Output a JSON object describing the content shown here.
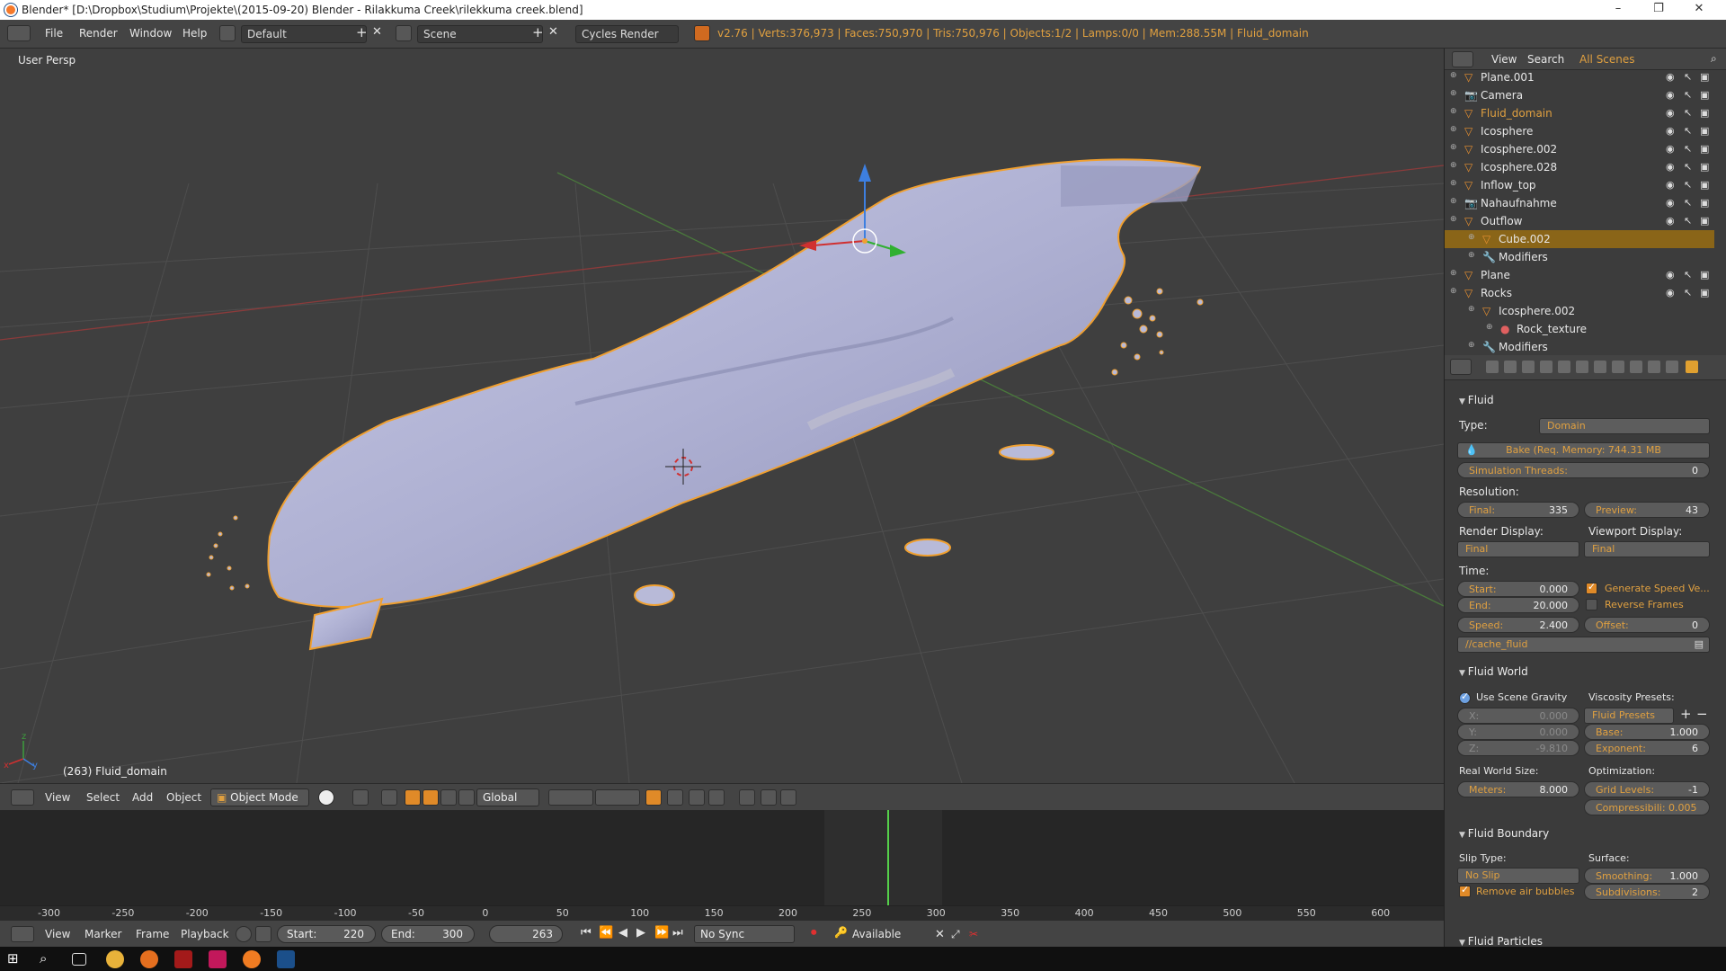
{
  "window": {
    "title": "Blender* [D:\\Dropbox\\Studium\\Projekte\\(2015-09-20) Blender - Rilakkuma Creek\\rilekkuma creek.blend]",
    "minimize": "–",
    "maximize": "❐",
    "close": "✕"
  },
  "info_header": {
    "menus": [
      "File",
      "Render",
      "Window",
      "Help"
    ],
    "screen_layout": "Default",
    "scene": "Scene",
    "render_engine": "Cycles Render",
    "stats": "v2.76 | Verts:376,973 | Faces:750,970 | Tris:750,976 | Objects:1/2 | Lamps:0/0 | Mem:288.55M | Fluid_domain"
  },
  "viewport": {
    "view_label": "User Persp",
    "object_label": "(263) Fluid_domain",
    "axis_x": "x",
    "axis_y": "y",
    "axis_z": "z"
  },
  "view3d_header": {
    "menus": [
      "View",
      "Select",
      "Add",
      "Object"
    ],
    "mode": "Object Mode",
    "orientation": "Global"
  },
  "timeline": {
    "ticks": [
      "-300",
      "-250",
      "-200",
      "-150",
      "-100",
      "-50",
      "0",
      "50",
      "100",
      "150",
      "200",
      "250",
      "300",
      "350",
      "400",
      "450",
      "500",
      "550",
      "600"
    ],
    "footer_menus": [
      "View",
      "Marker",
      "Frame",
      "Playback"
    ],
    "start_label": "Start:",
    "start_value": "220",
    "end_label": "End:",
    "end_value": "300",
    "current_frame": "263",
    "sync": "No Sync",
    "keying_set": "Available"
  },
  "outliner": {
    "header_menus": [
      "View",
      "Search"
    ],
    "display_mode": "All Scenes",
    "rows": [
      {
        "name": "Plane.001",
        "depth": 1,
        "type": "mesh"
      },
      {
        "name": "Camera",
        "depth": 1,
        "type": "camera"
      },
      {
        "name": "Fluid_domain",
        "depth": 1,
        "type": "mesh",
        "active": true
      },
      {
        "name": "Icosphere",
        "depth": 1,
        "type": "mesh"
      },
      {
        "name": "Icosphere.002",
        "depth": 1,
        "type": "mesh"
      },
      {
        "name": "Icosphere.028",
        "depth": 1,
        "type": "mesh"
      },
      {
        "name": "Inflow_top",
        "depth": 1,
        "type": "mesh"
      },
      {
        "name": "Nahaufnahme",
        "depth": 1,
        "type": "camera"
      },
      {
        "name": "Outflow",
        "depth": 1,
        "type": "mesh"
      },
      {
        "name": "Cube.002",
        "depth": 2,
        "type": "mesh",
        "selected": true
      },
      {
        "name": "Modifiers",
        "depth": 2,
        "type": "wrench"
      },
      {
        "name": "Plane",
        "depth": 1,
        "type": "mesh"
      },
      {
        "name": "Rocks",
        "depth": 1,
        "type": "mesh"
      },
      {
        "name": "Icosphere.002",
        "depth": 2,
        "type": "mesh"
      },
      {
        "name": "Rock_texture",
        "depth": 3,
        "type": "material"
      },
      {
        "name": "Modifiers",
        "depth": 2,
        "type": "wrench"
      }
    ]
  },
  "properties": {
    "fluid": {
      "title": "Fluid",
      "type_label": "Type:",
      "type_value": "Domain",
      "bake_label": "Bake (Req. Memory: 744.31 MB",
      "sim_threads_label": "Simulation Threads:",
      "sim_threads_value": "0",
      "resolution_label": "Resolution:",
      "final_label": "Final:",
      "final_value": "335",
      "preview_label": "Preview:",
      "preview_value": "43",
      "render_display_label": "Render Display:",
      "render_display_value": "Final",
      "viewport_display_label": "Viewport Display:",
      "viewport_display_value": "Final",
      "time_label": "Time:",
      "start_label": "Start:",
      "start_value": "0.000",
      "end_label": "End:",
      "end_value": "20.000",
      "speed_label": "Speed:",
      "speed_value": "2.400",
      "offset_label": "Offset:",
      "offset_value": "0",
      "generate_speed_label": "Generate Speed Ve...",
      "generate_speed_checked": true,
      "reverse_frames_label": "Reverse Frames",
      "reverse_frames_checked": false,
      "cache_path": "//cache_fluid"
    },
    "fluid_world": {
      "title": "Fluid World",
      "use_scene_gravity_label": "Use Scene Gravity",
      "x_label": "X:",
      "x_value": "0.000",
      "y_label": "Y:",
      "y_value": "0.000",
      "z_label": "Z:",
      "z_value": "-9.810",
      "viscosity_presets_label": "Viscosity Presets:",
      "fluid_presets": "Fluid Presets",
      "base_label": "Base:",
      "base_value": "1.000",
      "exponent_label": "Exponent:",
      "exponent_value": "6",
      "real_world_size_label": "Real World Size:",
      "meters_label": "Meters:",
      "meters_value": "8.000",
      "optimization_label": "Optimization:",
      "grid_levels_label": "Grid Levels:",
      "grid_levels_value": "-1",
      "compressibility_label": "Compressibili: 0.005"
    },
    "fluid_boundary": {
      "title": "Fluid Boundary",
      "slip_type_label": "Slip Type:",
      "slip_type_value": "No Slip",
      "surface_label": "Surface:",
      "smoothing_label": "Smoothing:",
      "smoothing_value": "1.000",
      "remove_air_label": "Remove air bubbles",
      "remove_air_checked": true,
      "subdivisions_label": "Subdivisions:",
      "subdivisions_value": "2"
    },
    "fluid_particles": {
      "title": "Fluid Particles"
    }
  },
  "colors": {
    "accent": "#e08a28",
    "stats_text": "#e0a040",
    "viewport_bg": "#3f3f3f",
    "fluid_mesh": "#b8bad8",
    "selection_outline": "#f0a030",
    "timeline_cursor": "#55d04a"
  }
}
